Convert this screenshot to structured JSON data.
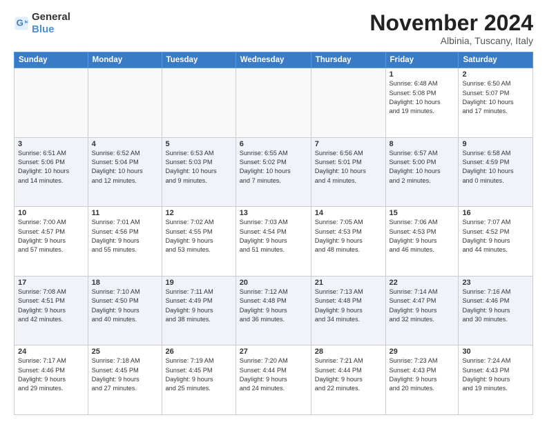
{
  "logo": {
    "text_general": "General",
    "text_blue": "Blue"
  },
  "header": {
    "month_title": "November 2024",
    "location": "Albinia, Tuscany, Italy"
  },
  "weekdays": [
    "Sunday",
    "Monday",
    "Tuesday",
    "Wednesday",
    "Thursday",
    "Friday",
    "Saturday"
  ],
  "weeks": [
    [
      {
        "day": "",
        "info": ""
      },
      {
        "day": "",
        "info": ""
      },
      {
        "day": "",
        "info": ""
      },
      {
        "day": "",
        "info": ""
      },
      {
        "day": "",
        "info": ""
      },
      {
        "day": "1",
        "info": "Sunrise: 6:48 AM\nSunset: 5:08 PM\nDaylight: 10 hours\nand 19 minutes."
      },
      {
        "day": "2",
        "info": "Sunrise: 6:50 AM\nSunset: 5:07 PM\nDaylight: 10 hours\nand 17 minutes."
      }
    ],
    [
      {
        "day": "3",
        "info": "Sunrise: 6:51 AM\nSunset: 5:06 PM\nDaylight: 10 hours\nand 14 minutes."
      },
      {
        "day": "4",
        "info": "Sunrise: 6:52 AM\nSunset: 5:04 PM\nDaylight: 10 hours\nand 12 minutes."
      },
      {
        "day": "5",
        "info": "Sunrise: 6:53 AM\nSunset: 5:03 PM\nDaylight: 10 hours\nand 9 minutes."
      },
      {
        "day": "6",
        "info": "Sunrise: 6:55 AM\nSunset: 5:02 PM\nDaylight: 10 hours\nand 7 minutes."
      },
      {
        "day": "7",
        "info": "Sunrise: 6:56 AM\nSunset: 5:01 PM\nDaylight: 10 hours\nand 4 minutes."
      },
      {
        "day": "8",
        "info": "Sunrise: 6:57 AM\nSunset: 5:00 PM\nDaylight: 10 hours\nand 2 minutes."
      },
      {
        "day": "9",
        "info": "Sunrise: 6:58 AM\nSunset: 4:59 PM\nDaylight: 10 hours\nand 0 minutes."
      }
    ],
    [
      {
        "day": "10",
        "info": "Sunrise: 7:00 AM\nSunset: 4:57 PM\nDaylight: 9 hours\nand 57 minutes."
      },
      {
        "day": "11",
        "info": "Sunrise: 7:01 AM\nSunset: 4:56 PM\nDaylight: 9 hours\nand 55 minutes."
      },
      {
        "day": "12",
        "info": "Sunrise: 7:02 AM\nSunset: 4:55 PM\nDaylight: 9 hours\nand 53 minutes."
      },
      {
        "day": "13",
        "info": "Sunrise: 7:03 AM\nSunset: 4:54 PM\nDaylight: 9 hours\nand 51 minutes."
      },
      {
        "day": "14",
        "info": "Sunrise: 7:05 AM\nSunset: 4:53 PM\nDaylight: 9 hours\nand 48 minutes."
      },
      {
        "day": "15",
        "info": "Sunrise: 7:06 AM\nSunset: 4:53 PM\nDaylight: 9 hours\nand 46 minutes."
      },
      {
        "day": "16",
        "info": "Sunrise: 7:07 AM\nSunset: 4:52 PM\nDaylight: 9 hours\nand 44 minutes."
      }
    ],
    [
      {
        "day": "17",
        "info": "Sunrise: 7:08 AM\nSunset: 4:51 PM\nDaylight: 9 hours\nand 42 minutes."
      },
      {
        "day": "18",
        "info": "Sunrise: 7:10 AM\nSunset: 4:50 PM\nDaylight: 9 hours\nand 40 minutes."
      },
      {
        "day": "19",
        "info": "Sunrise: 7:11 AM\nSunset: 4:49 PM\nDaylight: 9 hours\nand 38 minutes."
      },
      {
        "day": "20",
        "info": "Sunrise: 7:12 AM\nSunset: 4:48 PM\nDaylight: 9 hours\nand 36 minutes."
      },
      {
        "day": "21",
        "info": "Sunrise: 7:13 AM\nSunset: 4:48 PM\nDaylight: 9 hours\nand 34 minutes."
      },
      {
        "day": "22",
        "info": "Sunrise: 7:14 AM\nSunset: 4:47 PM\nDaylight: 9 hours\nand 32 minutes."
      },
      {
        "day": "23",
        "info": "Sunrise: 7:16 AM\nSunset: 4:46 PM\nDaylight: 9 hours\nand 30 minutes."
      }
    ],
    [
      {
        "day": "24",
        "info": "Sunrise: 7:17 AM\nSunset: 4:46 PM\nDaylight: 9 hours\nand 29 minutes."
      },
      {
        "day": "25",
        "info": "Sunrise: 7:18 AM\nSunset: 4:45 PM\nDaylight: 9 hours\nand 27 minutes."
      },
      {
        "day": "26",
        "info": "Sunrise: 7:19 AM\nSunset: 4:45 PM\nDaylight: 9 hours\nand 25 minutes."
      },
      {
        "day": "27",
        "info": "Sunrise: 7:20 AM\nSunset: 4:44 PM\nDaylight: 9 hours\nand 24 minutes."
      },
      {
        "day": "28",
        "info": "Sunrise: 7:21 AM\nSunset: 4:44 PM\nDaylight: 9 hours\nand 22 minutes."
      },
      {
        "day": "29",
        "info": "Sunrise: 7:23 AM\nSunset: 4:43 PM\nDaylight: 9 hours\nand 20 minutes."
      },
      {
        "day": "30",
        "info": "Sunrise: 7:24 AM\nSunset: 4:43 PM\nDaylight: 9 hours\nand 19 minutes."
      }
    ]
  ]
}
